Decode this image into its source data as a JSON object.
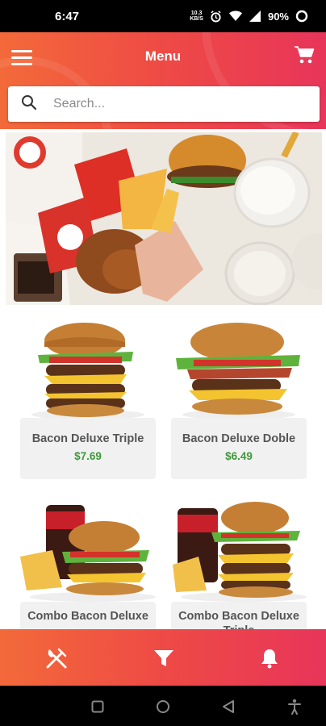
{
  "status_bar": {
    "time": "6:47",
    "net_speed_value": "10.3",
    "net_speed_unit": "KB/S",
    "battery": "90%",
    "icons": [
      "alarm-icon",
      "wifi-icon",
      "signal-icon",
      "battery-icon"
    ]
  },
  "header": {
    "title": "Menu",
    "menu_icon": "hamburger-icon",
    "cart_icon": "cart-icon"
  },
  "search": {
    "placeholder": "Search...",
    "value": "",
    "icon": "search-icon"
  },
  "products": [
    {
      "name": "Bacon Deluxe Triple",
      "price": "$7.69"
    },
    {
      "name": "Bacon Deluxe Doble",
      "price": "$6.49"
    },
    {
      "name": "Combo Bacon Deluxe",
      "price": ""
    },
    {
      "name": "Combo Bacon Deluxe Triple",
      "price": ""
    }
  ],
  "bottom_nav": {
    "items": [
      {
        "icon": "fork-knife-icon"
      },
      {
        "icon": "filter-icon"
      },
      {
        "icon": "bell-icon"
      }
    ]
  },
  "system_nav": [
    "recents-icon",
    "home-icon",
    "back-icon",
    "accessibility-icon"
  ],
  "colors": {
    "header_start": "#f36a3a",
    "header_end": "#e8355a",
    "price": "#3e9a3a",
    "card_bg": "#f1f1f1"
  }
}
